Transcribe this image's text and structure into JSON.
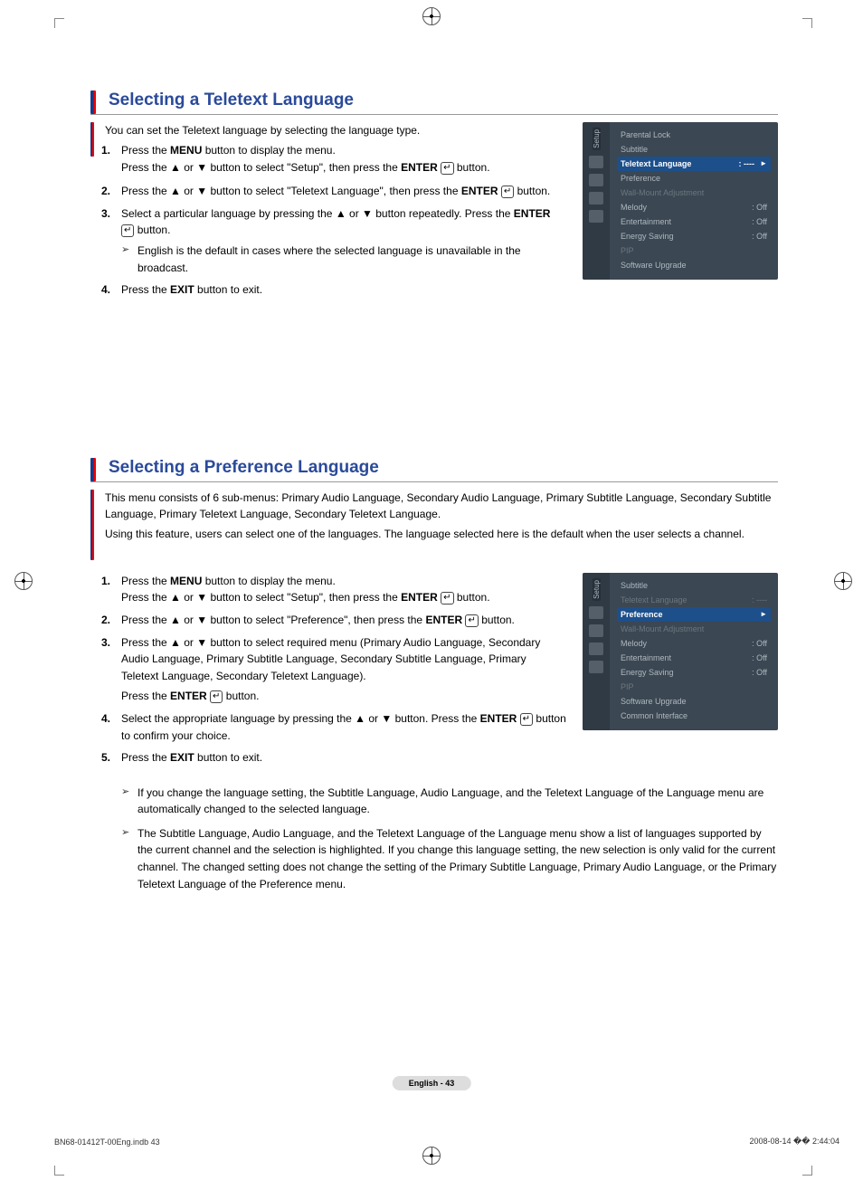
{
  "section1": {
    "title": "Selecting a Teletext Language",
    "intro": "You can set the Teletext language by selecting the language type.",
    "steps": {
      "s1a": "Press the ",
      "s1_menu": "MENU",
      "s1b": " button to display the menu.",
      "s1c": "Press the ▲ or ▼ button to select \"Setup\", then press the ",
      "s1_enter": "ENTER",
      "s1d": " button.",
      "s2a": "Press the ▲ or ▼ button to select \"Teletext Language\", then press the ",
      "s2_enter": "ENTER",
      "s2b": " button.",
      "s3a": "Select a particular language by pressing the ▲ or ▼ button repeatedly. Press the ",
      "s3_enter": "ENTER",
      "s3b": " button.",
      "s3_note": "English is the default in cases where the selected language is unavailable in the broadcast.",
      "s4a": "Press the ",
      "s4_exit": "EXIT",
      "s4b": " button to exit."
    }
  },
  "osd1": {
    "tab": "Setup",
    "items": [
      {
        "label": "Parental Lock",
        "value": "",
        "class": ""
      },
      {
        "label": "Subtitle",
        "value": "",
        "class": ""
      },
      {
        "label": "Teletext Language",
        "value": ": ----",
        "class": "sel"
      },
      {
        "label": "Preference",
        "value": "",
        "class": ""
      },
      {
        "label": "Wall-Mount Adjustment",
        "value": "",
        "class": "dim"
      },
      {
        "label": "Melody",
        "value": ": Off",
        "class": ""
      },
      {
        "label": "Entertainment",
        "value": ": Off",
        "class": ""
      },
      {
        "label": "Energy Saving",
        "value": ": Off",
        "class": ""
      },
      {
        "label": "PIP",
        "value": "",
        "class": "dim"
      },
      {
        "label": "Software Upgrade",
        "value": "",
        "class": ""
      }
    ]
  },
  "section2": {
    "title": "Selecting a Preference Language",
    "intro1": "This menu consists of 6 sub-menus: Primary Audio Language, Secondary Audio Language, Primary Subtitle Language, Secondary Subtitle Language, Primary Teletext Language, Secondary Teletext Language.",
    "intro2": "Using this feature, users can select one of the languages. The language selected here is the default when the user selects a channel.",
    "steps": {
      "s1a": "Press the ",
      "s1_menu": "MENU",
      "s1b": " button to display the menu.",
      "s1c": "Press the ▲ or ▼ button to select \"Setup\", then press the ",
      "s1_enter": "ENTER",
      "s1d": " button.",
      "s2a": "Press the ▲ or ▼ button to select \"Preference\", then press the ",
      "s2_enter": "ENTER",
      "s2b": " button.",
      "s3a": "Press the ▲ or ▼ button to select required menu (Primary Audio Language, Secondary Audio Language, Primary Subtitle Language, Secondary Subtitle Language, Primary Teletext Language, Secondary Teletext Language).",
      "s3b": "Press the ",
      "s3_enter": "ENTER",
      "s3c": " button.",
      "s4a": "Select the appropriate language by pressing the ▲ or ▼ button. Press the ",
      "s4_enter": "ENTER",
      "s4b": " button to confirm your choice.",
      "s5a": "Press the ",
      "s5_exit": "EXIT",
      "s5b": " button to exit."
    },
    "note1": "If you change the language setting, the Subtitle Language, Audio Language, and the Teletext Language of the Language menu are automatically changed to the selected language.",
    "note2": "The Subtitle Language, Audio Language, and the Teletext Language of the Language menu show a list of languages supported by the current channel and the selection is highlighted. If you change this language setting, the new selection is only valid for the current channel. The changed setting does not change the setting of the Primary Subtitle Language, Primary Audio Language, or the Primary Teletext Language of the Preference menu."
  },
  "osd2": {
    "tab": "Setup",
    "items": [
      {
        "label": "Subtitle",
        "value": "",
        "class": ""
      },
      {
        "label": "Teletext Language",
        "value": ": ----",
        "class": "dim"
      },
      {
        "label": "Preference",
        "value": "",
        "class": "sel"
      },
      {
        "label": "Wall-Mount Adjustment",
        "value": "",
        "class": "dim"
      },
      {
        "label": "Melody",
        "value": ": Off",
        "class": ""
      },
      {
        "label": "Entertainment",
        "value": ": Off",
        "class": ""
      },
      {
        "label": "Energy Saving",
        "value": ": Off",
        "class": ""
      },
      {
        "label": "PIP",
        "value": "",
        "class": "dim"
      },
      {
        "label": "Software Upgrade",
        "value": "",
        "class": ""
      },
      {
        "label": "Common Interface",
        "value": "",
        "class": ""
      }
    ]
  },
  "page_badge": "English - 43",
  "footer_left": "BN68-01412T-00Eng.indb   43",
  "footer_right": "2008-08-14   �� 2:44:04",
  "enter_glyph": "↵"
}
